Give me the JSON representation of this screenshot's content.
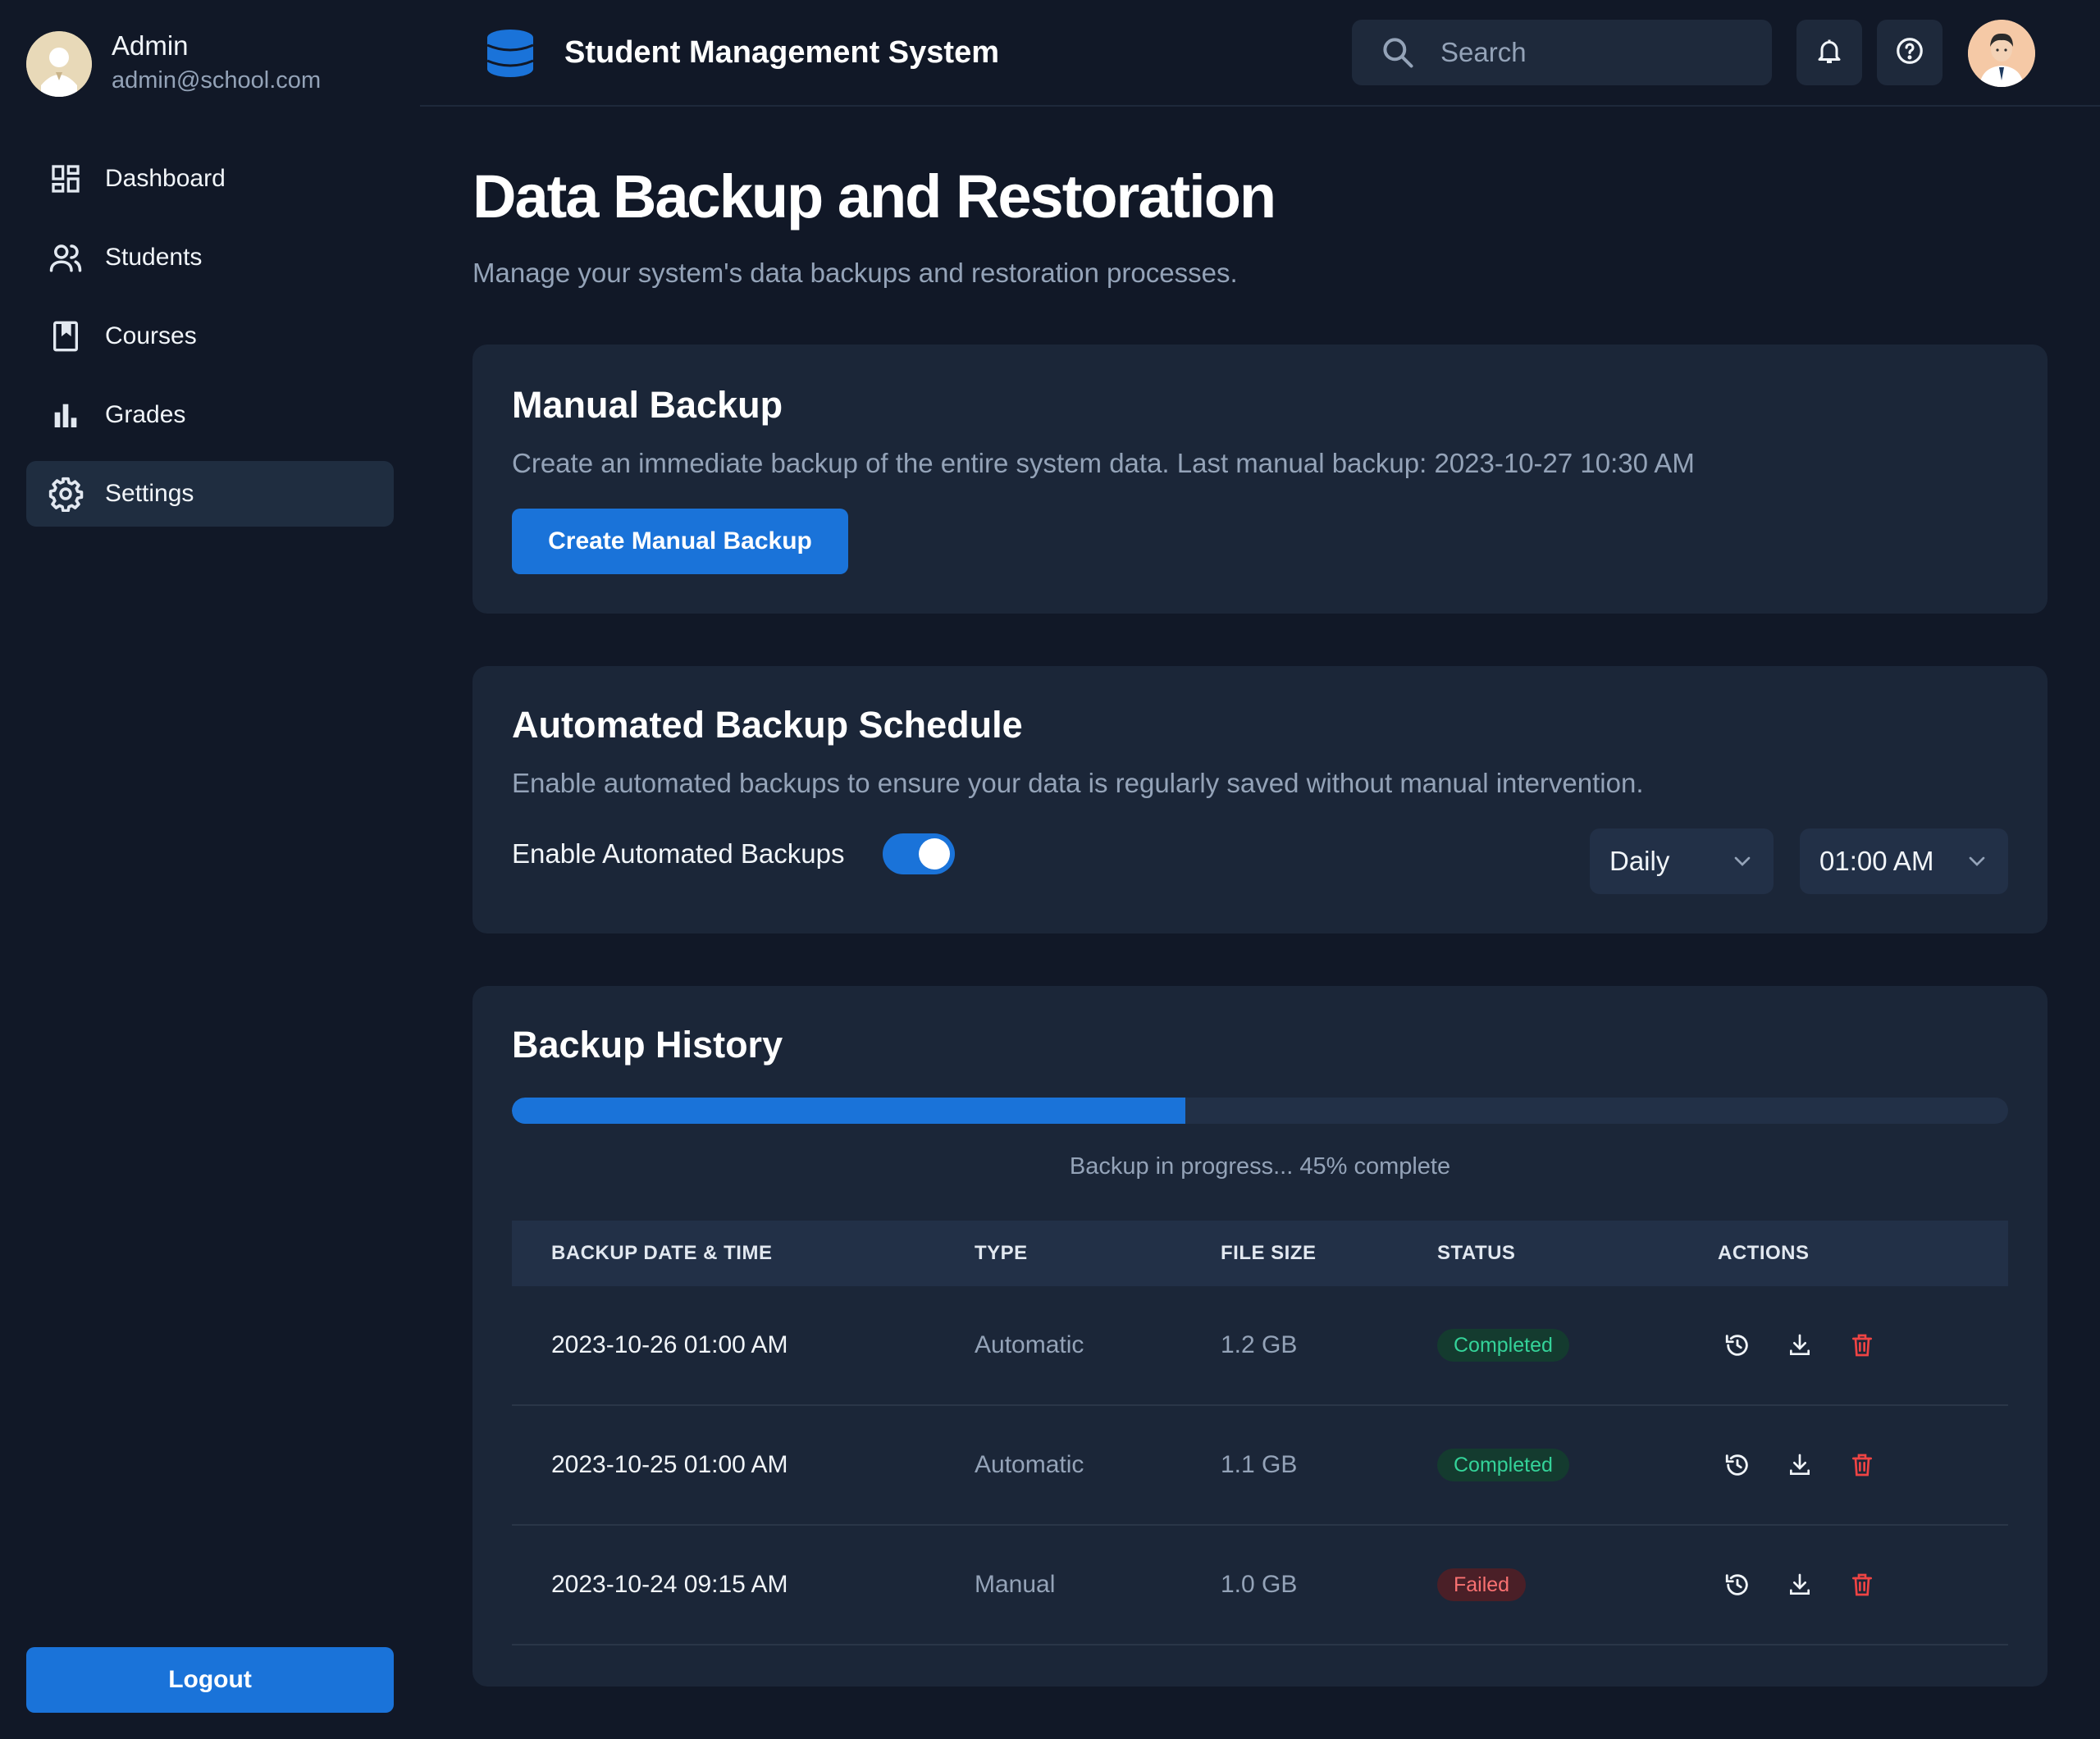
{
  "user": {
    "name": "Admin",
    "email": "admin@school.com"
  },
  "nav": [
    {
      "label": "Dashboard",
      "icon": "dashboard-icon"
    },
    {
      "label": "Students",
      "icon": "users-icon"
    },
    {
      "label": "Courses",
      "icon": "book-icon"
    },
    {
      "label": "Grades",
      "icon": "bar-chart-icon"
    },
    {
      "label": "Settings",
      "icon": "gear-icon",
      "active": true
    }
  ],
  "logout_label": "Logout",
  "header": {
    "app_title": "Student Management System",
    "search_placeholder": "Search"
  },
  "page": {
    "title": "Data Backup and Restoration",
    "subtitle": "Manage your system's data backups and restoration processes."
  },
  "manual_backup": {
    "title": "Manual Backup",
    "description": "Create an immediate backup of the entire system data. Last manual backup: 2023-10-27 10:30 AM",
    "button_label": "Create Manual Backup"
  },
  "schedule": {
    "title": "Automated Backup Schedule",
    "description": "Enable automated backups to ensure your data is regularly saved without manual intervention.",
    "toggle_label": "Enable Automated Backups",
    "enabled": true,
    "frequency": "Daily",
    "time": "01:00 AM"
  },
  "history": {
    "title": "Backup History",
    "progress_percent": 45,
    "progress_text": "Backup in progress... 45% complete",
    "columns": [
      "BACKUP DATE & TIME",
      "TYPE",
      "FILE SIZE",
      "STATUS",
      "ACTIONS"
    ],
    "rows": [
      {
        "date": "2023-10-26 01:00 AM",
        "type": "Automatic",
        "size": "1.2 GB",
        "status": "Completed"
      },
      {
        "date": "2023-10-25 01:00 AM",
        "type": "Automatic",
        "size": "1.1 GB",
        "status": "Completed"
      },
      {
        "date": "2023-10-24 09:15 AM",
        "type": "Manual",
        "size": "1.0 GB",
        "status": "Failed"
      }
    ]
  },
  "colors": {
    "accent": "#1a73d9",
    "background": "#111827",
    "card": "#1b2638",
    "success": "#34d399",
    "danger": "#ef4444"
  }
}
